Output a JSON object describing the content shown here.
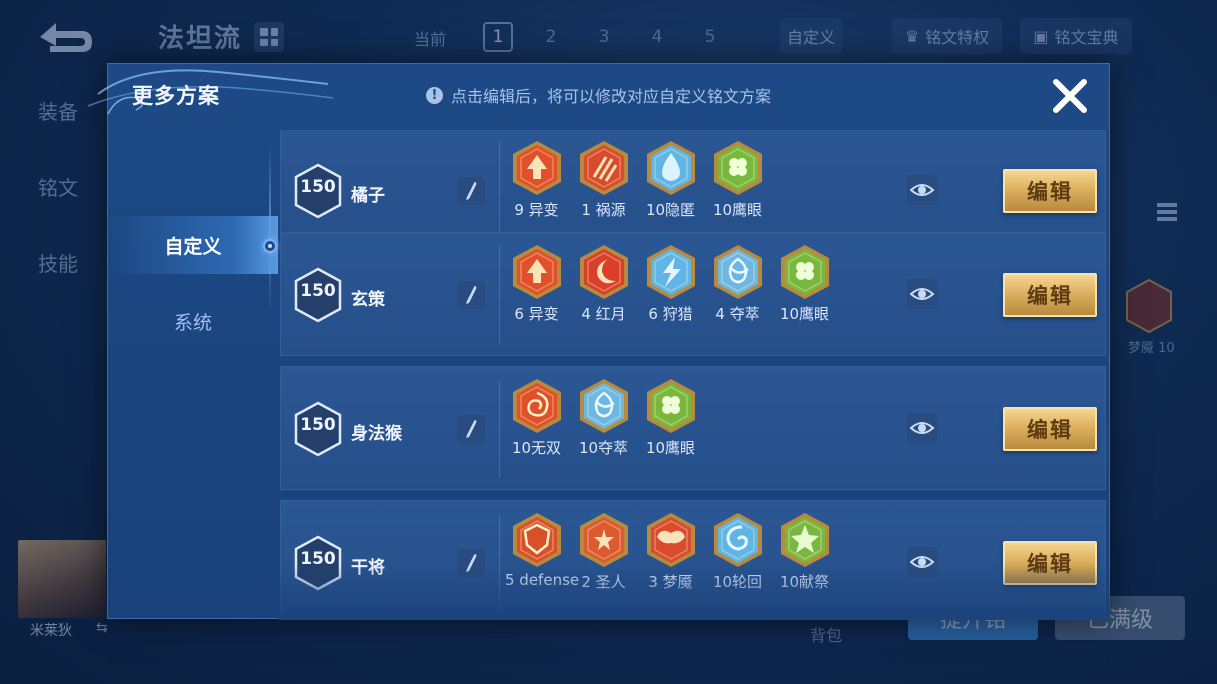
{
  "background": {
    "title": "法坦流",
    "current_label": "当前",
    "pages": [
      "1",
      "2",
      "3",
      "4",
      "5"
    ],
    "active_page": "1",
    "custom_label": "自定义",
    "privilege_label": "铭文特权",
    "codex_label": "铭文宝典",
    "side_tabs": [
      "装备",
      "铭文",
      "技能"
    ],
    "right_rune_label": "梦魇 10",
    "hero_name": "米莱狄",
    "bag_label": "背包",
    "btn_a_label": "提升铭",
    "btn_b_label": "已满级"
  },
  "modal": {
    "title": "更多方案",
    "hint": "点击编辑后，将可以修改对应自定义铭文方案",
    "sidebar": [
      {
        "label": "自定义",
        "active": true
      },
      {
        "label": "系统",
        "active": false
      }
    ],
    "edit_label": "编辑",
    "plans": [
      {
        "level": "150",
        "name": "橘子",
        "runes": [
          {
            "label": "9 异变",
            "color": "#e0502a",
            "glyph": "arrow"
          },
          {
            "label": "1 祸源",
            "color": "#d84b2c",
            "glyph": "claw"
          },
          {
            "label": "10隐匿",
            "color": "#5fb6e6",
            "glyph": "drop"
          },
          {
            "label": "10鹰眼",
            "color": "#79b83e",
            "glyph": "clover"
          }
        ]
      },
      {
        "level": "150",
        "name": "玄策",
        "runes": [
          {
            "label": "6 异变",
            "color": "#e0502a",
            "glyph": "arrow"
          },
          {
            "label": "4 红月",
            "color": "#d8402a",
            "glyph": "moon"
          },
          {
            "label": "6 狩猎",
            "color": "#5fb6e6",
            "glyph": "bolt"
          },
          {
            "label": "4 夺萃",
            "color": "#6db8e2",
            "glyph": "knot"
          },
          {
            "label": "10鹰眼",
            "color": "#79b83e",
            "glyph": "clover"
          }
        ]
      },
      {
        "level": "150",
        "name": "身法猴",
        "runes": [
          {
            "label": "10无双",
            "color": "#e0502a",
            "glyph": "swirl"
          },
          {
            "label": "10夺萃",
            "color": "#6db8e2",
            "glyph": "knot"
          },
          {
            "label": "10鹰眼",
            "color": "#79b83e",
            "glyph": "clover"
          }
        ]
      },
      {
        "level": "150",
        "name": "干将",
        "runes": [
          {
            "label": "5 defense",
            "color": "#d8502a",
            "glyph": "shield"
          },
          {
            "label": "2 圣人",
            "color": "#dc5a30",
            "glyph": "flower"
          },
          {
            "label": "3 梦魇",
            "color": "#d84b2c",
            "glyph": "wings"
          },
          {
            "label": "10轮回",
            "color": "#5fb6e6",
            "glyph": "spiral"
          },
          {
            "label": "10献祭",
            "color": "#79b83e",
            "glyph": "star"
          }
        ]
      }
    ]
  }
}
